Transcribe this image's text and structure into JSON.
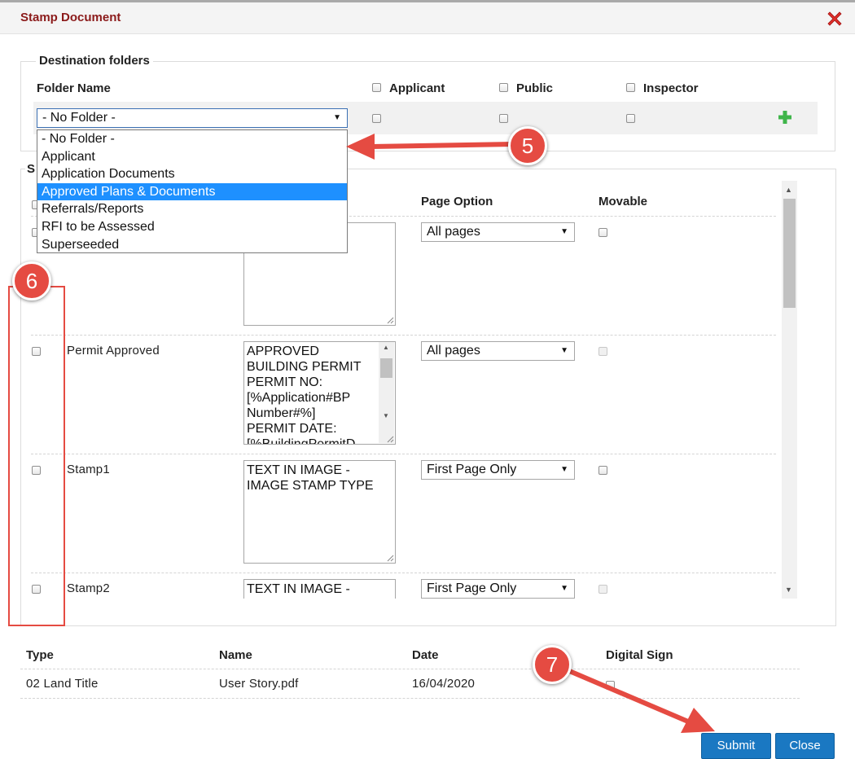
{
  "dialog": {
    "title": "Stamp Document"
  },
  "destination": {
    "legend": "Destination folders",
    "headers": {
      "folder_name": "Folder Name",
      "applicant": "Applicant",
      "public": "Public",
      "inspector": "Inspector"
    },
    "folder_select_value": "- No Folder -",
    "options": [
      "- No Folder -",
      "Applicant",
      "Application Documents",
      "Approved Plans & Documents",
      "Referrals/Reports",
      "RFI to be Assessed",
      "Superseeded"
    ],
    "selected_option": "Approved Plans & Documents"
  },
  "stamps": {
    "legend_initial": "S",
    "headers": {
      "page_option": "Page Option",
      "movable": "Movable"
    },
    "rows": [
      {
        "name": "",
        "text": "",
        "page_option": "All pages",
        "movable_enabled": true
      },
      {
        "name": "Permit Approved",
        "text": "APPROVED\nBUILDING PERMIT\nPERMIT NO:\n[%Application#BP\nNumber#%]\nPERMIT DATE:\n[%BuildingPermitD",
        "page_option": "All pages",
        "movable_enabled": false
      },
      {
        "name": "Stamp1",
        "text": "TEXT IN IMAGE -\nIMAGE STAMP TYPE",
        "page_option": "First Page Only",
        "movable_enabled": true
      },
      {
        "name": "Stamp2",
        "text": "TEXT IN IMAGE -\nIMAGE STAMP TYPE",
        "page_option": "First Page Only",
        "movable_enabled": false
      }
    ]
  },
  "documents": {
    "headers": {
      "type": "Type",
      "name": "Name",
      "date": "Date",
      "digital_sign": "Digital Sign"
    },
    "rows": [
      {
        "type": "02 Land Title",
        "name": "User Story.pdf",
        "date": "16/04/2020"
      }
    ]
  },
  "buttons": {
    "submit": "Submit",
    "close": "Close"
  },
  "annotations": {
    "step5": "5",
    "step6": "6",
    "step7": "7",
    "color": "#e54b42"
  }
}
